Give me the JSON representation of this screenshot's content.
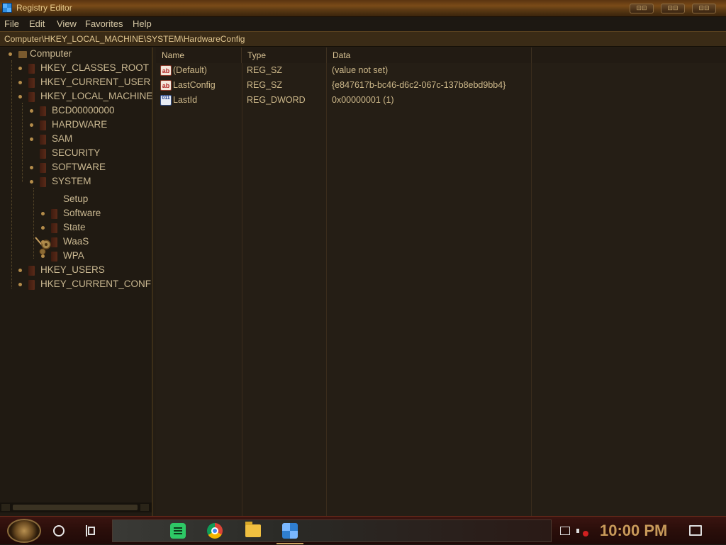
{
  "window": {
    "title": "Registry Editor",
    "controls": {
      "minimize": "⊟⊟",
      "maximize": "⊟⊟",
      "close": "⊟⊟"
    }
  },
  "menu": {
    "items": [
      "File",
      "Edit",
      "View",
      "Favorites",
      "Help"
    ]
  },
  "address": {
    "path": "Computer\\HKEY_LOCAL_MACHINE\\SYSTEM\\HardwareConfig"
  },
  "tree": {
    "items": [
      {
        "label": "Computer",
        "level": 0
      },
      {
        "label": "HKEY_CLASSES_ROOT",
        "level": 1
      },
      {
        "label": "HKEY_CURRENT_USER",
        "level": 1
      },
      {
        "label": "HKEY_LOCAL_MACHINE",
        "level": 1,
        "expanded": true
      },
      {
        "label": "BCD00000000",
        "level": 2
      },
      {
        "label": "HARDWARE",
        "level": 2
      },
      {
        "label": "SAM",
        "level": 2
      },
      {
        "label": "SECURITY",
        "level": 2
      },
      {
        "label": "SOFTWARE",
        "level": 2
      },
      {
        "label": "SYSTEM",
        "level": 2,
        "expanded": true
      },
      {
        "label": "Setup",
        "level": 3
      },
      {
        "label": "Software",
        "level": 3
      },
      {
        "label": "State",
        "level": 3
      },
      {
        "label": "WaaS",
        "level": 3
      },
      {
        "label": "WPA",
        "level": 3
      },
      {
        "label": "HKEY_USERS",
        "level": 1
      },
      {
        "label": "HKEY_CURRENT_CONFIG",
        "level": 1
      }
    ]
  },
  "values": {
    "columns": {
      "name": "Name",
      "type": "Type",
      "data": "Data"
    },
    "rows": [
      {
        "icon": "ab",
        "name": "(Default)",
        "type": "REG_SZ",
        "data": "(value not set)"
      },
      {
        "icon": "ab",
        "name": "LastConfig",
        "type": "REG_SZ",
        "data": "{e847617b-bc46-d6c2-067c-137b8ebd9bb4}"
      },
      {
        "icon": "011",
        "name": "LastId",
        "type": "REG_DWORD",
        "data": "0x00000001 (1)"
      }
    ]
  },
  "taskbar": {
    "clock": "10:00 PM",
    "pinned_icons": [
      "notes-icon",
      "chrome-icon",
      "file-explorer-icon",
      "regedit-icon"
    ]
  },
  "colors": {
    "accent": "#c89a5a",
    "text": "#cbb992",
    "background": "#241d14"
  }
}
